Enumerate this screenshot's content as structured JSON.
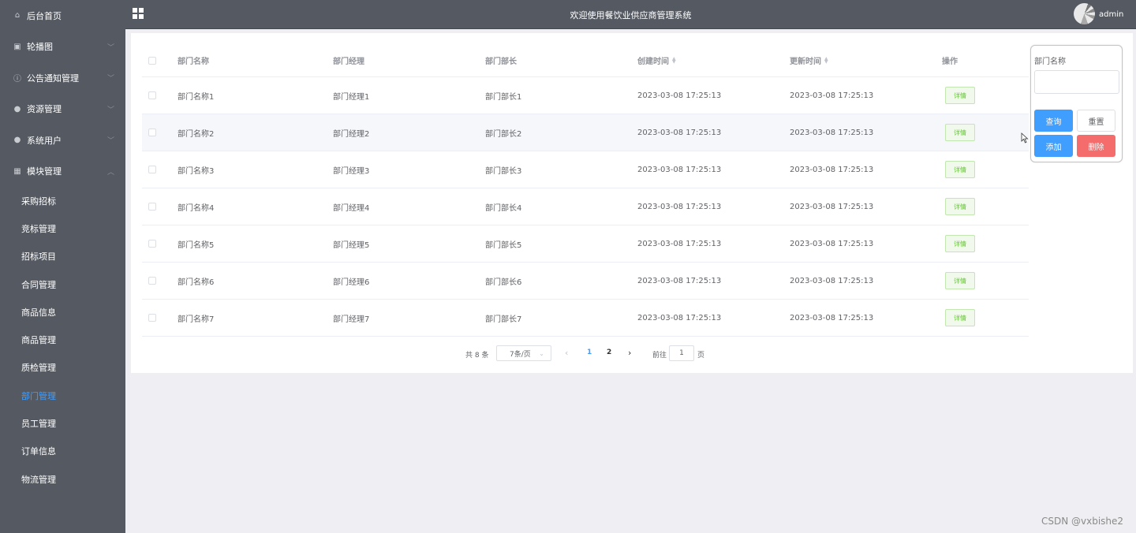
{
  "sidebar": {
    "items": [
      {
        "label": "后台首页",
        "icon": "home-icon",
        "has_arrow": false
      },
      {
        "label": "轮播图",
        "icon": "image-icon",
        "has_arrow": true
      },
      {
        "label": "公告通知管理",
        "icon": "info-circle-icon",
        "has_arrow": true
      },
      {
        "label": "资源管理",
        "icon": "location-pin-icon",
        "has_arrow": true
      },
      {
        "label": "系统用户",
        "icon": "user-icon",
        "has_arrow": true
      },
      {
        "label": "模块管理",
        "icon": "grid-icon",
        "has_arrow": true,
        "expanded": true
      }
    ],
    "sub_items": [
      {
        "label": "采购招标",
        "active": false
      },
      {
        "label": "竞标管理",
        "active": false
      },
      {
        "label": "招标项目",
        "active": false
      },
      {
        "label": "合同管理",
        "active": false
      },
      {
        "label": "商品信息",
        "active": false
      },
      {
        "label": "商品管理",
        "active": false
      },
      {
        "label": "质检管理",
        "active": false
      },
      {
        "label": "部门管理",
        "active": true
      },
      {
        "label": "员工管理",
        "active": false
      },
      {
        "label": "订单信息",
        "active": false
      },
      {
        "label": "物流管理",
        "active": false
      }
    ]
  },
  "header": {
    "title": "欢迎使用餐饮业供应商管理系统",
    "username": "admin"
  },
  "table": {
    "columns": [
      "部门名称",
      "部门经理",
      "部门部长",
      "创建时间",
      "更新时间",
      "操作"
    ],
    "sortable_columns": [
      3,
      4
    ],
    "detail_label": "详情",
    "rows": [
      {
        "name": "部门名称1",
        "manager": "部门经理1",
        "minister": "部门部长1",
        "created": "2023-03-08 17:25:13",
        "updated": "2023-03-08 17:25:13"
      },
      {
        "name": "部门名称2",
        "manager": "部门经理2",
        "minister": "部门部长2",
        "created": "2023-03-08 17:25:13",
        "updated": "2023-03-08 17:25:13"
      },
      {
        "name": "部门名称3",
        "manager": "部门经理3",
        "minister": "部门部长3",
        "created": "2023-03-08 17:25:13",
        "updated": "2023-03-08 17:25:13"
      },
      {
        "name": "部门名称4",
        "manager": "部门经理4",
        "minister": "部门部长4",
        "created": "2023-03-08 17:25:13",
        "updated": "2023-03-08 17:25:13"
      },
      {
        "name": "部门名称5",
        "manager": "部门经理5",
        "minister": "部门部长5",
        "created": "2023-03-08 17:25:13",
        "updated": "2023-03-08 17:25:13"
      },
      {
        "name": "部门名称6",
        "manager": "部门经理6",
        "minister": "部门部长6",
        "created": "2023-03-08 17:25:13",
        "updated": "2023-03-08 17:25:13"
      },
      {
        "name": "部门名称7",
        "manager": "部门经理7",
        "minister": "部门部长7",
        "created": "2023-03-08 17:25:13",
        "updated": "2023-03-08 17:25:13"
      }
    ]
  },
  "pagination": {
    "total_text": "共 8 条",
    "page_size": "7条/页",
    "pages": [
      "1",
      "2"
    ],
    "current_page": "1",
    "goto_label": "前往",
    "goto_value": "1",
    "page_suffix": "页"
  },
  "search": {
    "label": "部门名称",
    "input_value": "",
    "query_label": "查询",
    "reset_label": "重置",
    "add_label": "添加",
    "delete_label": "删除"
  },
  "watermark": "CSDN @vxbishe2",
  "colors": {
    "sidebar_bg": "#555a62",
    "primary": "#409eff",
    "danger": "#f56c6c",
    "success": "#67c23a"
  }
}
